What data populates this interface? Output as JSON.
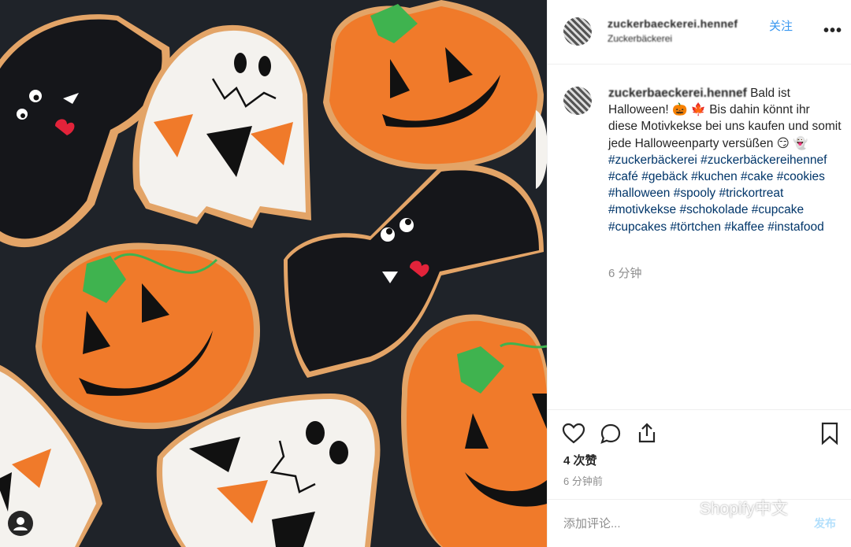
{
  "header": {
    "username": "zuckerbaeckerei.hennef",
    "follow_label": "关注",
    "subtitle": "Zuckerbäckerei",
    "more_label": "•••"
  },
  "caption": {
    "username": "zuckerbaeckerei.hennef",
    "text_1": "Bald ist Halloween! 🎃 🍁  Bis dahin könnt ihr diese Motivkekse bei uns kaufen und somit jede Halloweenparty versüßen 😏 👻 ",
    "hashtags": "#zuckerbäckerei #zuckerbäckereihennef #café #gebäck #kuchen #cake #cookies #halloween #spooly #trickortreat #motivkekse #schokolade #cupcake #cupcakes #törtchen #kaffee #instafood",
    "time": "6 分钟"
  },
  "actions": {
    "likes": "4 次赞",
    "time": "6 分钟前"
  },
  "comment": {
    "placeholder": "添加评论...",
    "post_label": "发布"
  },
  "watermark": "Shopify中文",
  "colors": {
    "link": "#003569",
    "follow": "#3897f0",
    "muted": "#8e8e8e",
    "pumpkin": "#f07a2a",
    "bg_photo": "#1f2329"
  },
  "icons": [
    "heart-icon",
    "comment-icon",
    "share-icon",
    "bookmark-icon",
    "user-icon"
  ]
}
